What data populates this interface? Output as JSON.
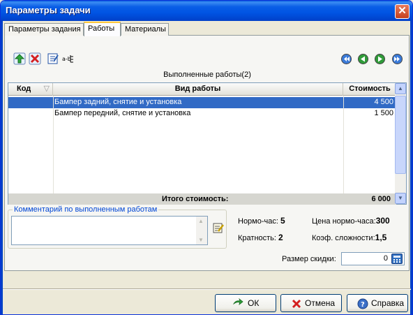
{
  "window": {
    "title": "Параметры задачи"
  },
  "tabs": [
    {
      "label": "Параметры задания"
    },
    {
      "label": "Работы"
    },
    {
      "label": "Материалы"
    }
  ],
  "toolbar": {
    "icons": [
      "add-green-arrow-icon",
      "delete-icon",
      "edit-icon",
      "filter-icon"
    ],
    "nav_icons": [
      "first-icon",
      "prev-icon",
      "next-icon",
      "last-icon"
    ]
  },
  "grid": {
    "caption": "Выполненные работы(2)",
    "columns": [
      "Код",
      "Вид работы",
      "Стоимость"
    ],
    "rows": [
      {
        "code": "",
        "work": "Бампер задний, снятие и установка",
        "cost": "4 500"
      },
      {
        "code": "",
        "work": "Бампер передний, снятие и установка",
        "cost": "1 500"
      }
    ],
    "total_label": "Итого стоимость:",
    "total_value": "6 000"
  },
  "comment": {
    "legend": "Комментарий по выполненным работам",
    "value": ""
  },
  "info": {
    "norm_hour_label": "Нормо-час:",
    "norm_hour_value": "5",
    "price_label": "Цена нормо-часа:",
    "price_value": "300",
    "multiplicity_label": "Кратность:",
    "multiplicity_value": "2",
    "complexity_label": "Коэф. сложности:",
    "complexity_value": "1,5"
  },
  "discount": {
    "label": "Размер скидки:",
    "value": "0"
  },
  "buttons": {
    "ok": "ОК",
    "cancel": "Отмена",
    "help": "Справка"
  },
  "colors": {
    "titlebar": "#0054e3",
    "selection": "#316ac5",
    "tab_highlight": "#ffc83c"
  }
}
